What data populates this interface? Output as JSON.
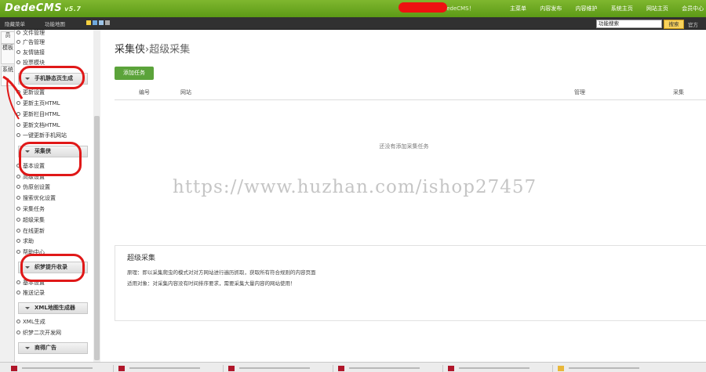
{
  "app": {
    "logo": "DedeCMS",
    "version": "v5.7",
    "welcome": "!您好，欢迎使用DedeCMS！"
  },
  "topnav": [
    "主菜单",
    "内容发布",
    "内容维护",
    "系统主页",
    "网站主页",
    "会员中心"
  ],
  "toolbar": {
    "hide_menu": "隐藏菜单",
    "function_map": "功能地图",
    "search_value": "功能搜索",
    "search_button": "搜索",
    "extra": "官方"
  },
  "vtabs": [
    "员",
    "模板",
    "系统"
  ],
  "sidebar": {
    "top_items": [
      "文件管理",
      "广告管理",
      "友情链接",
      "投票模块"
    ],
    "groups": [
      {
        "title": "手机静态页生成",
        "items": [
          "更新设置",
          "更新主页HTML",
          "更新栏目HTML",
          "更新文档HTML",
          "一键更新手机网站"
        ]
      },
      {
        "title": "采集侠",
        "items": [
          "基本设置",
          "高级设置",
          "伪原创设置",
          "搜索优化设置",
          "采集任务",
          "超级采集",
          "在线更新",
          "求助",
          "帮助中心"
        ]
      },
      {
        "title": "织梦提升收录",
        "items": [
          "基本设置",
          "推送记录"
        ]
      },
      {
        "title": "XML地图生成器",
        "items": [
          "XML生成",
          "织梦二次开发网"
        ]
      },
      {
        "title": "商得广告",
        "items": []
      }
    ]
  },
  "main": {
    "breadcrumb_root": "采集侠",
    "breadcrumb_sep": "›",
    "breadcrumb_current": "超级采集",
    "add_button": "添加任务",
    "columns": [
      "编号",
      "网站",
      "管理",
      "采集"
    ],
    "empty_text": "还没有添加采集任务",
    "info_title": "超级采集",
    "info_line1": "原理：即以采集爬虫的模式对对方网站进行遍历抓取，获取所有符合规则的内容页面",
    "info_line2": "适用对象：对采集内容没有时间排序要求，需要采集大量内容的网站使用！"
  },
  "watermark": "https://www.huzhan.com/ishop27457",
  "colors": {
    "header_green": "#6aa823",
    "button_green": "#5ba33a",
    "annotation_red": "#e01818"
  }
}
